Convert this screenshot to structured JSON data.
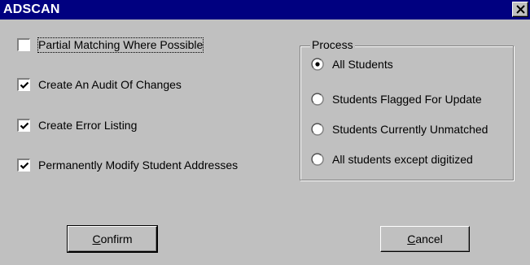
{
  "window": {
    "title": "ADSCAN"
  },
  "options": [
    {
      "label": "Partial Matching Where Possible",
      "checked": false
    },
    {
      "label": "Create An Audit Of Changes",
      "checked": true
    },
    {
      "label": "Create Error Listing",
      "checked": true
    },
    {
      "label": "Permanently Modify Student Addresses",
      "checked": true
    }
  ],
  "process": {
    "title": "Process",
    "items": [
      {
        "label": "All Students",
        "selected": true
      },
      {
        "label": "Students Flagged For Update",
        "selected": false
      },
      {
        "label": "Students Currently Unmatched",
        "selected": false
      },
      {
        "label": "All students except digitized",
        "selected": false
      }
    ]
  },
  "buttons": {
    "confirm": {
      "mnemonic": "C",
      "rest": "onfirm"
    },
    "cancel": {
      "mnemonic": "C",
      "rest": "ancel"
    }
  },
  "colors": {
    "titlebar": "#000080",
    "face": "#c0c0c0"
  }
}
